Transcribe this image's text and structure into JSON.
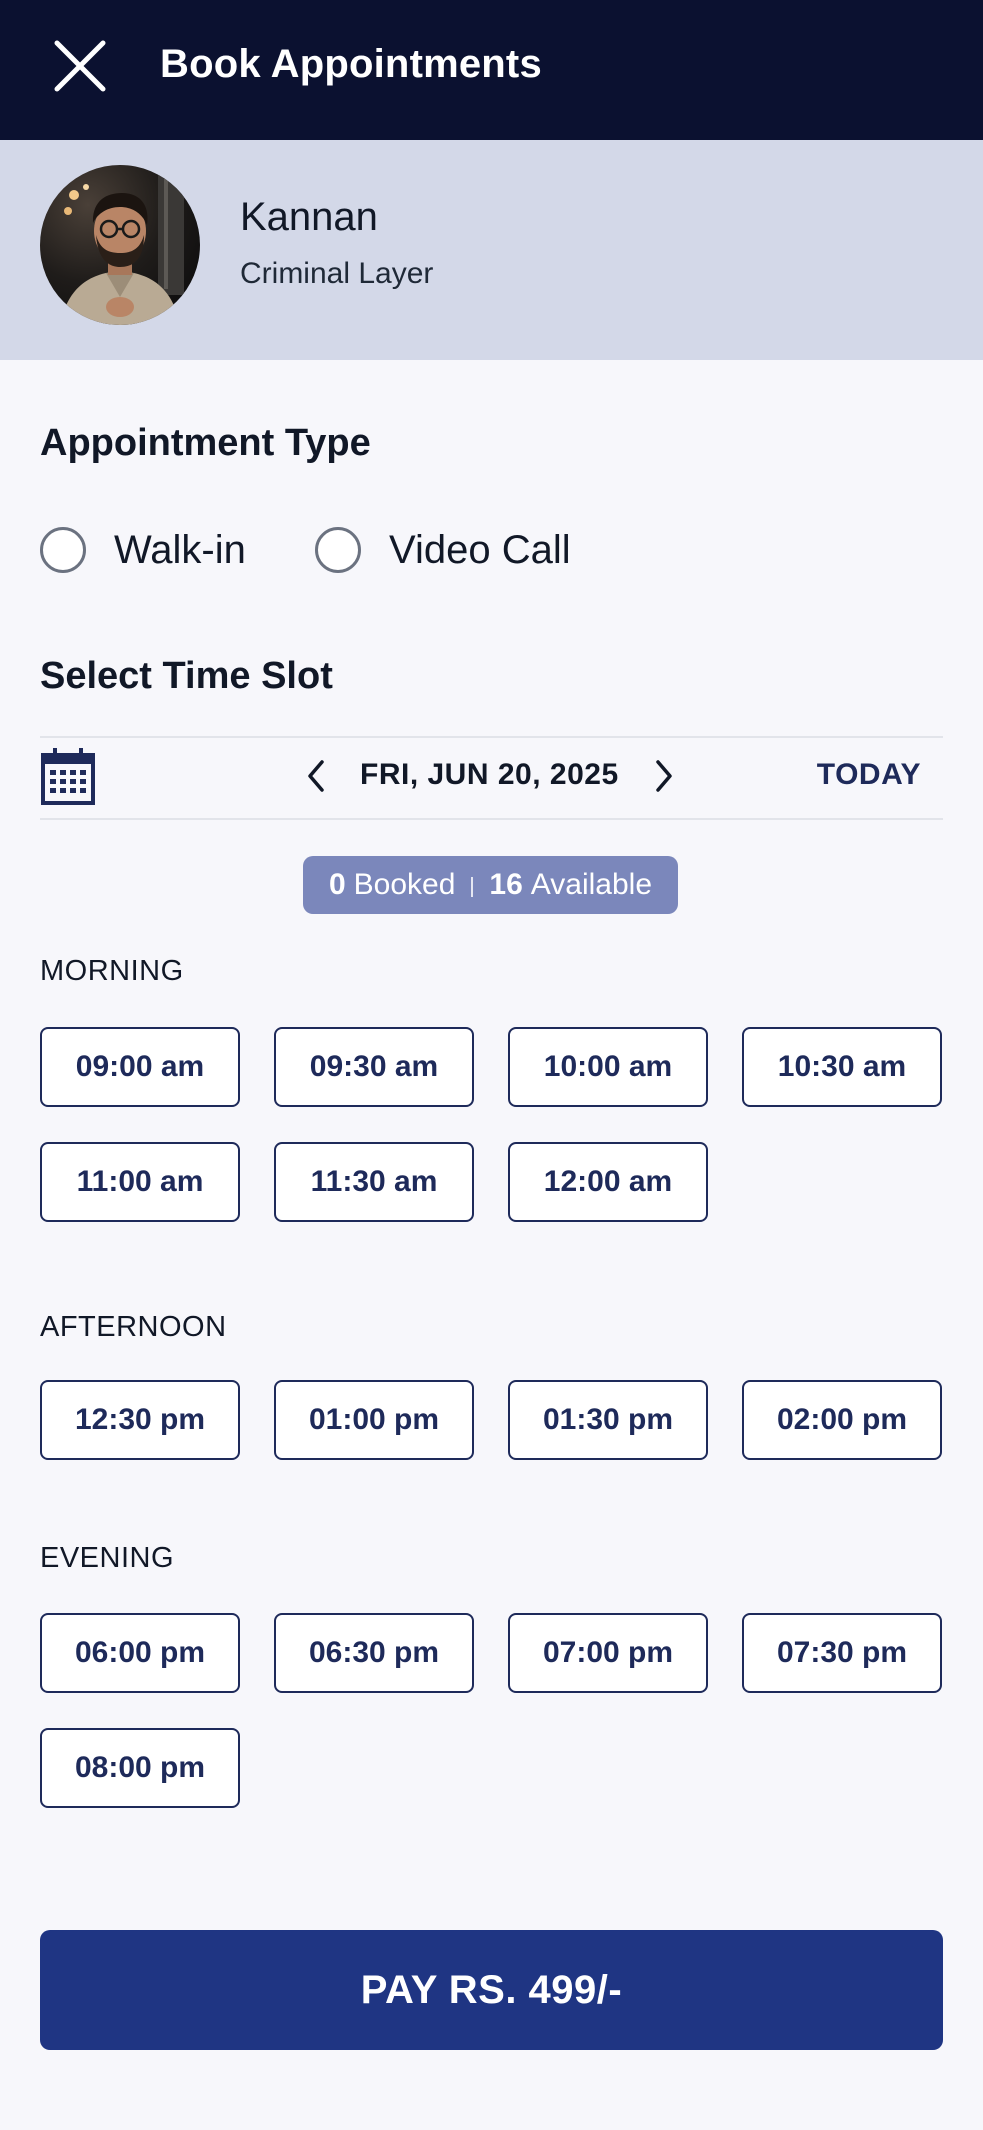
{
  "header": {
    "title": "Book Appointments",
    "close_icon": "close-icon"
  },
  "profile": {
    "name": "Kannan",
    "role": "Criminal Layer"
  },
  "appointment_type": {
    "heading": "Appointment Type",
    "options": [
      {
        "label": "Walk-in",
        "selected": false
      },
      {
        "label": "Video Call",
        "selected": false
      }
    ]
  },
  "time_slot": {
    "heading": "Select Time Slot",
    "date": "FRI, JUN 20, 2025",
    "today_label": "TODAY",
    "summary": {
      "booked_count": "0",
      "booked_label": "Booked",
      "available_count": "16",
      "available_label": "Available"
    },
    "periods": [
      {
        "label": "MORNING",
        "slots": [
          "09:00 am",
          "09:30 am",
          "10:00 am",
          "10:30 am",
          "11:00 am",
          "11:30 am",
          "12:00 am"
        ]
      },
      {
        "label": "AFTERNOON",
        "slots": [
          "12:30 pm",
          "01:00 pm",
          "01:30 pm",
          "02:00 pm"
        ]
      },
      {
        "label": "EVENING",
        "slots": [
          "06:00 pm",
          "06:30 pm",
          "07:00 pm",
          "07:30 pm",
          "08:00 pm"
        ]
      }
    ]
  },
  "pay_button": {
    "label": "PAY RS. 499/-"
  },
  "colors": {
    "header_bg": "#0b1130",
    "profile_bg": "#d3d8e8",
    "accent": "#1f3583",
    "slot_border": "#1e2a5a",
    "pill_bg": "#7b87bb"
  }
}
